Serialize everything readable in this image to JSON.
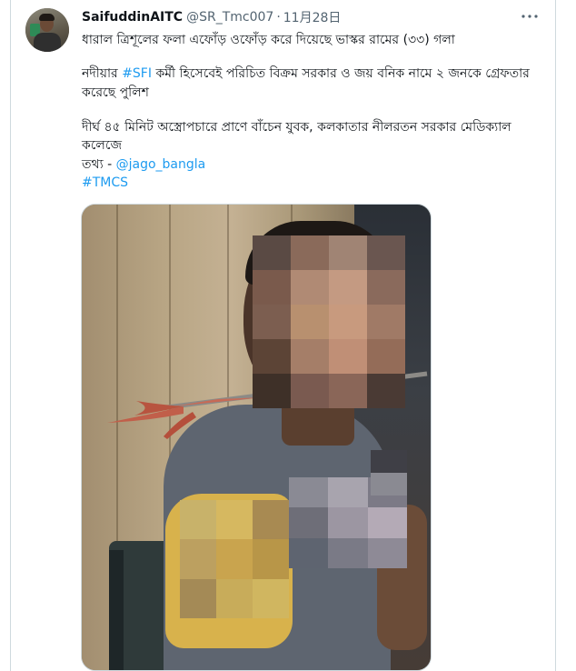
{
  "tweet": {
    "author_name": "SaifuddinAITC",
    "author_handle": "@SR_Tmc007",
    "separator": "·",
    "date": "11月28日",
    "more_icon": "more-options-icon",
    "lines": {
      "line1": "ধারাল ত্রিশূলের ফলা এফোঁড় ওফোঁড় করে দিয়েছে ভাস্কর রামের (৩৩) গলা",
      "line2_before": "নদীয়ার ",
      "line2_hashtag": "#SFI",
      "line2_after": " কর্মী হিসেবেই পরিচিত বিক্রম সরকার ও জয় বনিক নামে ২ জনকে গ্রেফতার",
      "line3": "করেছে পুলিশ",
      "line4": "দীর্ঘ ৪৫ মিনিট অস্ত্রোপচারে প্রাণে বাঁচেন যুবক, কলকাতার নীলরতন সরকার মেডিক্যাল কলেজে",
      "line5_prefix": "তথ্য - ",
      "line5_mention": "@jago_bangla",
      "line6_hashtag": "#TMCS"
    },
    "media": {
      "mosaic_colors": {
        "face": [
          "#5a4a44",
          "#8a6a5a",
          "#a08474",
          "#6a5650",
          "#7a5a4c",
          "#b08a74",
          "#c49a82",
          "#8a6a5c",
          "#7c5e50",
          "#b8906f",
          "#c89a7e",
          "#a07a66",
          "#5c4436",
          "#a57e68",
          "#c08f76",
          "#946c58",
          "#3e3028",
          "#7a5a50",
          "#8a6658",
          "#4a3a34"
        ],
        "chest": [
          "#8a8a94",
          "#a8a4ae",
          "#7c7a86",
          "#6e6e78",
          "#9c96a2",
          "#b4aab6",
          "#5e6470",
          "#7a7a86",
          "#8e8a96"
        ],
        "tag": [
          "#3f3f46",
          "#8a8a92"
        ],
        "arm": [
          "#c8b26a",
          "#d6b860",
          "#a88a52",
          "#bca060",
          "#c9a44e",
          "#b89648",
          "#a48a56",
          "#c8ac5a",
          "#d0b660"
        ]
      }
    }
  }
}
